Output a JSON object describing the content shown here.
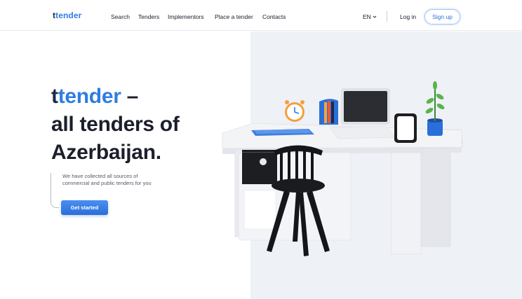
{
  "header": {
    "logo_part1": "t",
    "logo_part2": "tender",
    "nav": [
      "Search",
      "Tenders",
      "Implementors",
      "Place a tender",
      "Contacts"
    ],
    "lang": "EN",
    "login": "Log in",
    "signup": "Sign up"
  },
  "hero": {
    "title_part1": "t",
    "title_part2": "tender",
    "title_dash": " –",
    "title_line2": "all tenders of",
    "title_line3": "Azerbaijan.",
    "description": "We have collected all sources of commercial and public tenders for you",
    "cta": "Get started"
  },
  "colors": {
    "brand_blue": "#2f7de1",
    "brand_dark": "#1b2a45",
    "panel_bg": "#eef1f5"
  },
  "icons": {
    "lang_dropdown": "chevron-down-icon",
    "illustration": "desk-illustration"
  }
}
